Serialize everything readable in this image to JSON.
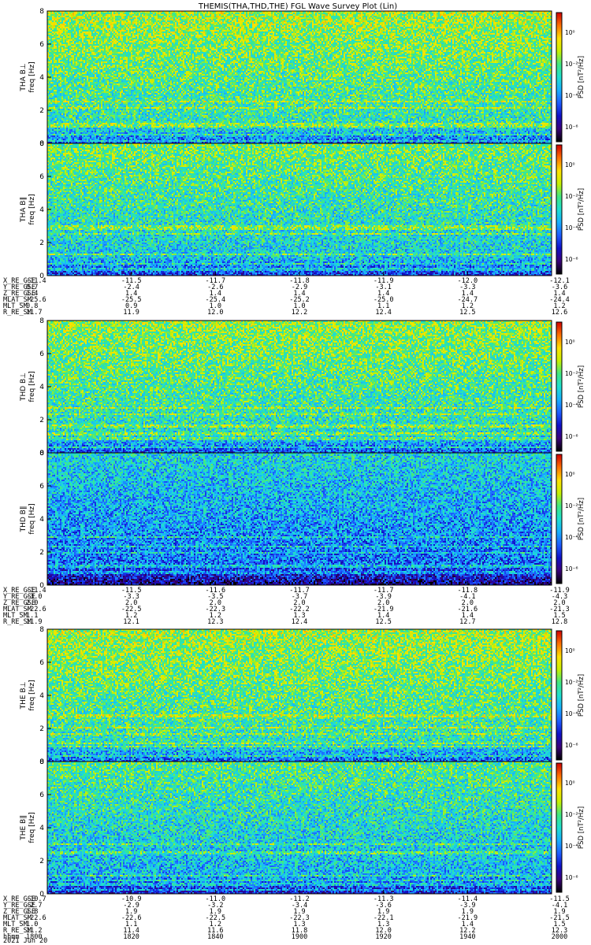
{
  "title": "THEMIS(THA,THD,THE) FGL Wave Survey Plot (Lin)",
  "date_label": "2021 Jun 20",
  "colorbar_label": "PSD [nT²/Hz]",
  "colorbar_ticks": [
    "10⁰",
    "10⁻²",
    "10⁻⁴",
    "10⁻⁶"
  ],
  "colors": {
    "spectrogram_scale": [
      "#000000",
      "#3a007a",
      "#1010c8",
      "#1e5cff",
      "#18b0ff",
      "#1fe0d0",
      "#40e880",
      "#c8f000",
      "#ffe000",
      "#ff7000",
      "#d00000"
    ]
  },
  "chart_data": [
    {
      "type": "heatmap",
      "probe": "THA",
      "panels": [
        {
          "name": "THA B⊥",
          "ylabel": "freq [Hz]",
          "ylim": [
            0,
            8
          ],
          "yticks": [
            "0",
            "2",
            "4",
            "6",
            "8"
          ]
        },
        {
          "name": "THA B∥",
          "ylabel": "freq [Hz]",
          "ylim": [
            0,
            8
          ],
          "yticks": [
            "0",
            "2",
            "4",
            "6",
            "8"
          ]
        }
      ],
      "colorbar": {
        "label": "PSD [nT²/Hz]",
        "scale": "log"
      },
      "ephemeris": {
        "labels": [
          "X_RE_GSE",
          "Y_RE_GSE",
          "Z_RE_GSE",
          "MLAT_SM",
          "MLT_SM",
          "R_RE_SM"
        ],
        "values": [
          [
            "-11.4",
            "-11.5",
            "-11.7",
            "-11.8",
            "-11.9",
            "-12.0",
            "-12.1"
          ],
          [
            "0.7",
            "-2.4",
            "-2.6",
            "-2.9",
            "-3.1",
            "-3.3",
            "-3.6"
          ],
          [
            "1.4",
            "1.4",
            "1.4",
            "1.4",
            "1.4",
            "1.4",
            "1.4"
          ],
          [
            "-25.6",
            "-25.5",
            "-25.4",
            "-25.2",
            "-25.0",
            "-24.7",
            "-24.4"
          ],
          [
            "0.8",
            "0.9",
            "1.0",
            "1.0",
            "1.1",
            "1.2",
            "1.2"
          ],
          [
            "11.7",
            "11.9",
            "12.0",
            "12.2",
            "12.4",
            "12.5",
            "12.6"
          ]
        ]
      }
    },
    {
      "type": "heatmap",
      "probe": "THD",
      "panels": [
        {
          "name": "THD B⊥",
          "ylabel": "freq [Hz]",
          "ylim": [
            0,
            8
          ],
          "yticks": [
            "0",
            "2",
            "4",
            "6",
            "8"
          ]
        },
        {
          "name": "THD B∥",
          "ylabel": "freq [Hz]",
          "ylim": [
            0,
            8
          ],
          "yticks": [
            "0",
            "2",
            "4",
            "6",
            "8"
          ]
        }
      ],
      "colorbar": {
        "label": "PSD [nT²/Hz]",
        "scale": "log"
      },
      "ephemeris": {
        "labels": [
          "X_RE_GSE",
          "Y_RE_GSE",
          "Z_RE_GSE",
          "MLAT_SM",
          "MLT_SM",
          "R_RE_SM"
        ],
        "values": [
          [
            "-11.4",
            "-11.5",
            "-11.6",
            "-11.7",
            "-11.7",
            "-11.8",
            "-11.9"
          ],
          [
            "-3.0",
            "-3.3",
            "-3.5",
            "-3.7",
            "-3.9",
            "-4.1",
            "-4.3"
          ],
          [
            "2.0",
            "2.0",
            "2.0",
            "2.0",
            "2.0",
            "2.0",
            "2.0"
          ],
          [
            "-22.6",
            "-22.5",
            "-22.3",
            "-22.2",
            "-21.9",
            "-21.6",
            "-21.3"
          ],
          [
            "1.1",
            "1.2",
            "1.2",
            "1.3",
            "1.4",
            "1.4",
            "1.5"
          ],
          [
            "11.9",
            "12.1",
            "12.3",
            "12.4",
            "12.5",
            "12.7",
            "12.8"
          ]
        ]
      }
    },
    {
      "type": "heatmap",
      "probe": "THE",
      "panels": [
        {
          "name": "THE B⊥",
          "ylabel": "freq [Hz]",
          "ylim": [
            0,
            8
          ],
          "yticks": [
            "0",
            "2",
            "4",
            "6",
            "8"
          ]
        },
        {
          "name": "THE B∥",
          "ylabel": "freq [Hz]",
          "ylim": [
            0,
            8
          ],
          "yticks": [
            "0",
            "2",
            "4",
            "6",
            "8"
          ]
        }
      ],
      "colorbar": {
        "label": "PSD [nT²/Hz]",
        "scale": "log"
      },
      "ephemeris": {
        "labels": [
          "X_RE_GSE",
          "Y_RE_GSE",
          "Z_RE_GSE",
          "MLAT_SM",
          "MLT_SM",
          "R_RE_SM",
          "hhmm"
        ],
        "values": [
          [
            "-10.7",
            "-10.9",
            "-11.0",
            "-11.2",
            "-11.3",
            "-11.4",
            "-11.5"
          ],
          [
            "-2.7",
            "-2.9",
            "-3.2",
            "-3.4",
            "-3.6",
            "-3.9",
            "-4.1"
          ],
          [
            "1.8",
            "1.9",
            "1.9",
            "1.9",
            "1.9",
            "1.9",
            "1.9"
          ],
          [
            "-22.6",
            "-22.6",
            "-22.5",
            "-22.3",
            "-22.1",
            "-21.9",
            "-21.5"
          ],
          [
            "1.0",
            "1.1",
            "1.2",
            "1.3",
            "1.3",
            "1.4",
            "1.5"
          ],
          [
            "11.2",
            "11.4",
            "11.6",
            "11.8",
            "12.0",
            "12.2",
            "12.3"
          ],
          [
            "1800",
            "1820",
            "1840",
            "1900",
            "1920",
            "1940",
            "2000"
          ]
        ]
      }
    }
  ]
}
